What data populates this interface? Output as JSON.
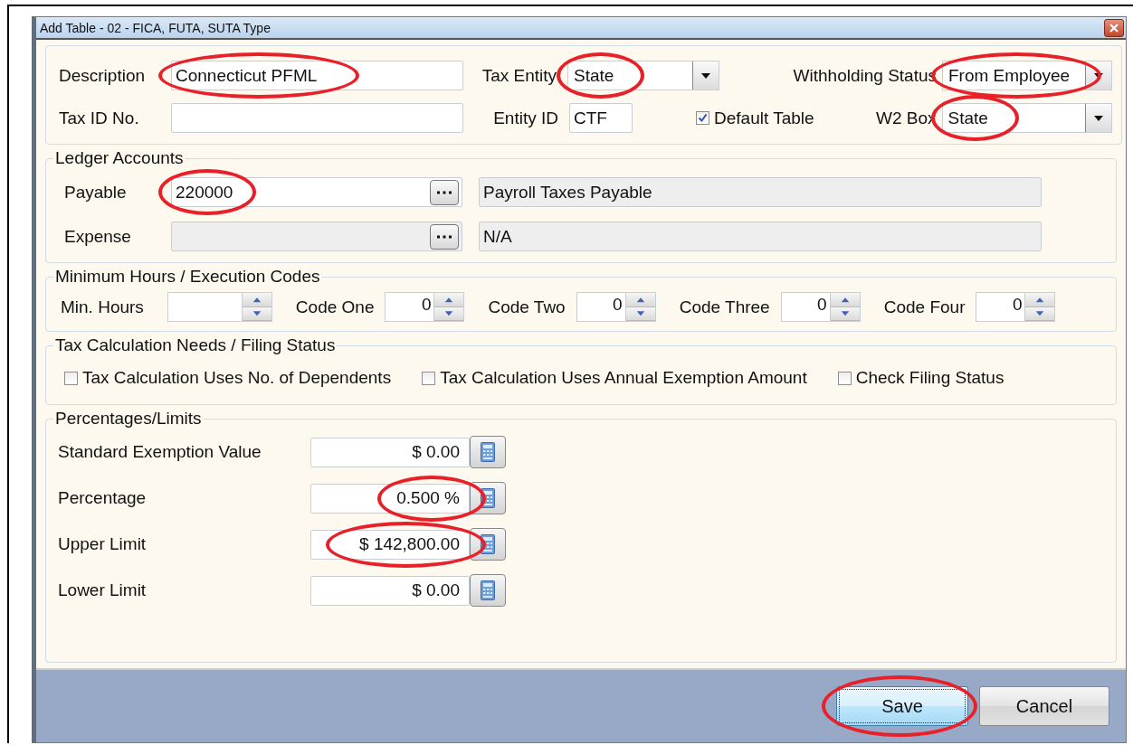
{
  "window": {
    "title": "Add Table - 02 - FICA, FUTA, SUTA Type"
  },
  "general": {
    "description": {
      "label": "Description",
      "value": "Connecticut PFML",
      "circled": true
    },
    "tax_entity": {
      "label": "Tax Entity",
      "value": "State",
      "circled": true
    },
    "withholding_status": {
      "label": "Withholding Status",
      "value": "From Employee",
      "circled": true
    },
    "tax_id_no": {
      "label": "Tax ID No."
    },
    "entity_id": {
      "label": "Entity ID",
      "value": "CTF"
    },
    "default_table": {
      "label": "Default Table",
      "checked": true
    },
    "w2_box": {
      "label": "W2 Box",
      "value": "State",
      "circled": true
    }
  },
  "ledger": {
    "legend": "Ledger Accounts",
    "rows": [
      {
        "label": "Payable",
        "account": "220000",
        "description": "Payroll Taxes Payable",
        "disabled": false,
        "circled": true
      },
      {
        "label": "Expense",
        "description": "N/A",
        "disabled": true,
        "circled": false
      }
    ]
  },
  "hours": {
    "legend": "Minimum Hours / Execution Codes",
    "items": [
      {
        "label": "Min. Hours"
      },
      {
        "label": "Code One",
        "value": "0"
      },
      {
        "label": "Code Two",
        "value": "0"
      },
      {
        "label": "Code Three",
        "value": "0"
      },
      {
        "label": "Code Four",
        "value": "0"
      }
    ]
  },
  "tax_calc": {
    "legend": "Tax Calculation Needs / Filing Status",
    "options": [
      {
        "label": "Tax Calculation Uses No. of  Dependents",
        "checked": false
      },
      {
        "label": "Tax Calculation Uses Annual Exemption Amount",
        "checked": false
      },
      {
        "label": "Check Filing Status",
        "checked": false
      }
    ]
  },
  "limits": {
    "legend": "Percentages/Limits",
    "rows": [
      {
        "label": "Standard Exemption Value",
        "value": "$ 0.00",
        "circled": false
      },
      {
        "label": "Percentage",
        "value": "0.500 %",
        "circled": true
      },
      {
        "label": "Upper Limit",
        "value": "$ 142,800.00",
        "circled": true
      },
      {
        "label": "Lower Limit",
        "value": "$ 0.00",
        "circled": false
      }
    ]
  },
  "buttons": [
    {
      "label": "Save",
      "focused": true,
      "circled": true
    },
    {
      "label": "Cancel",
      "focused": false,
      "circled": false
    }
  ]
}
